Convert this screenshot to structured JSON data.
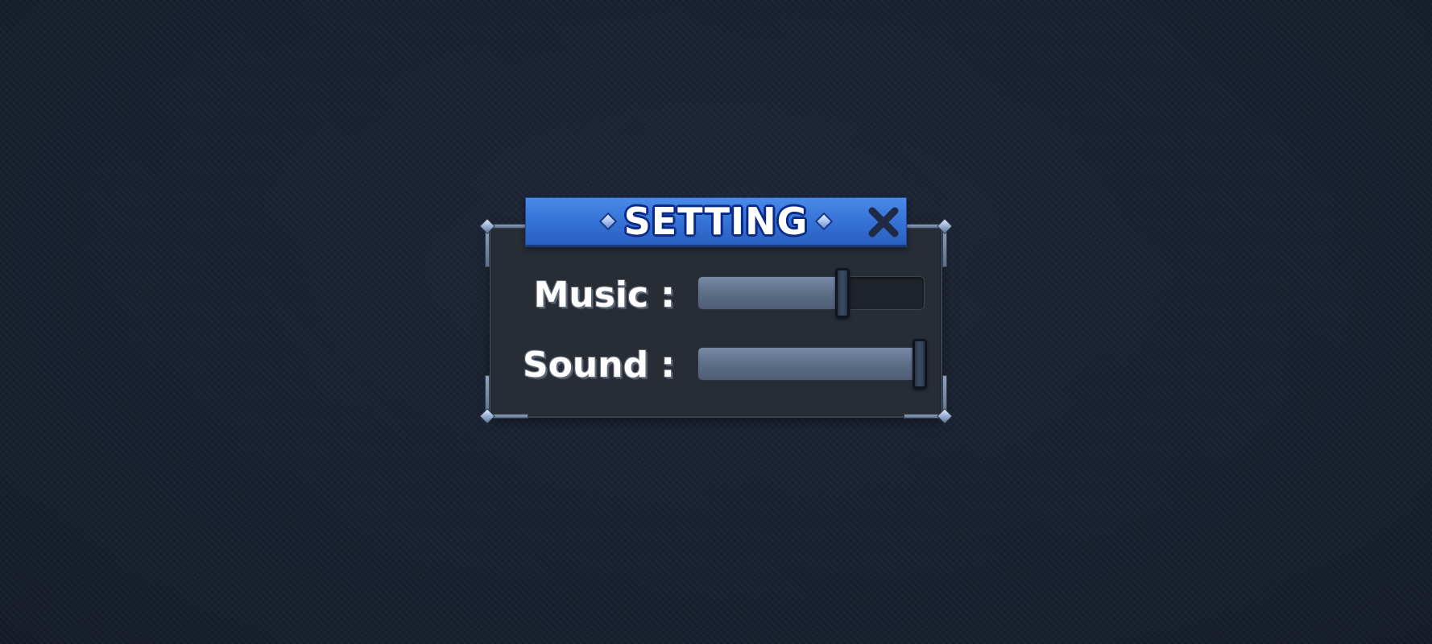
{
  "dialog": {
    "title": "SETTING",
    "close_icon": "close-icon"
  },
  "settings": {
    "music": {
      "label": "Music :",
      "level": 0.64
    },
    "sound": {
      "label": "Sound :",
      "level": 0.98
    }
  },
  "colors": {
    "background": "#1a2230",
    "panel": "#272c35",
    "title_banner": "#3573d6",
    "title_outline": "#0b2a8a",
    "slider_fill": "#5b6c86",
    "slider_handle": "#2a3648"
  }
}
